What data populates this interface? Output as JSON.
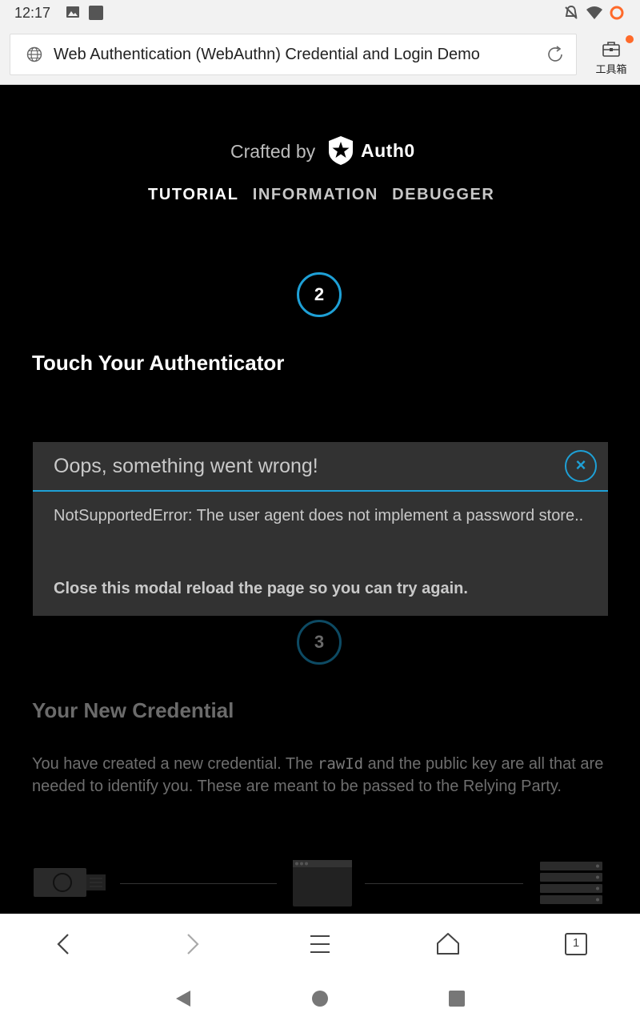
{
  "status_bar": {
    "time": "12:17"
  },
  "browser": {
    "url_title": "Web Authentication (WebAuthn) Credential and Login Demo",
    "toolbox_label": "工具箱",
    "tab_count": "1"
  },
  "header": {
    "crafted_by": "Crafted by",
    "brand": "Auth0",
    "tabs": [
      {
        "label": "TUTORIAL",
        "active": true
      },
      {
        "label": "INFORMATION",
        "active": false
      },
      {
        "label": "DEBUGGER",
        "active": false
      }
    ]
  },
  "step2": {
    "number": "2",
    "title": "Touch Your Authenticator"
  },
  "modal": {
    "title": "Oops, something went wrong!",
    "close_glyph": "×",
    "message": "NotSupportedError: The user agent does not implement a password store..",
    "hint": "Close this modal reload the page so you can try again."
  },
  "step3": {
    "number": "3",
    "title": "Your New Credential",
    "desc_before": "You have created a new credential. The ",
    "desc_code": "rawId",
    "desc_after": " and the public key are all that are needed to identify you. These are meant to be passed to the Relying Party."
  },
  "colors": {
    "accent": "#1ea0d6",
    "background": "#000000",
    "modal_bg": "#323232"
  }
}
